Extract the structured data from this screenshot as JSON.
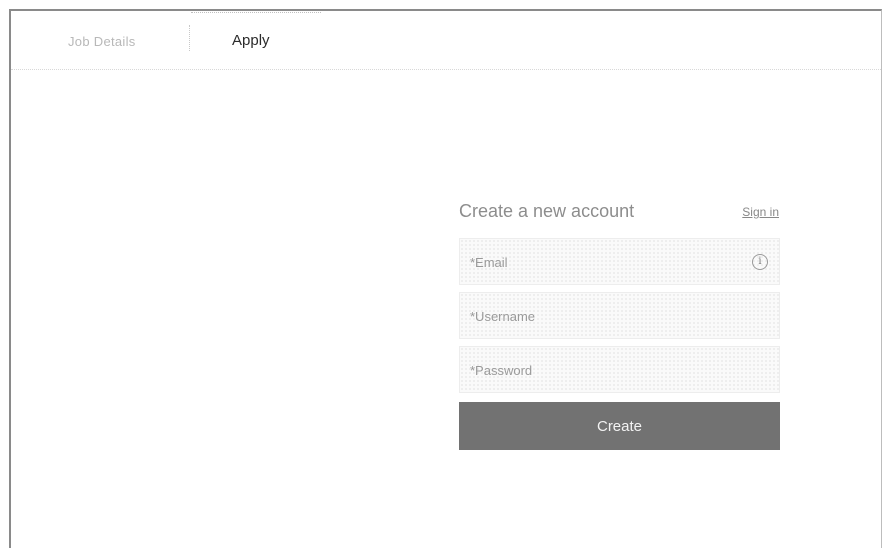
{
  "tabs": {
    "job_details": "Job Details",
    "apply": "Apply"
  },
  "form": {
    "title": "Create a new account",
    "sign_in": "Sign in",
    "email_placeholder": "*Email",
    "username_placeholder": "*Username",
    "password_placeholder": "*Password",
    "info_icon": "info-icon",
    "info_glyph": "i",
    "create_label": "Create"
  },
  "colors": {
    "button": "#727272",
    "title": "#8d8d8d"
  }
}
